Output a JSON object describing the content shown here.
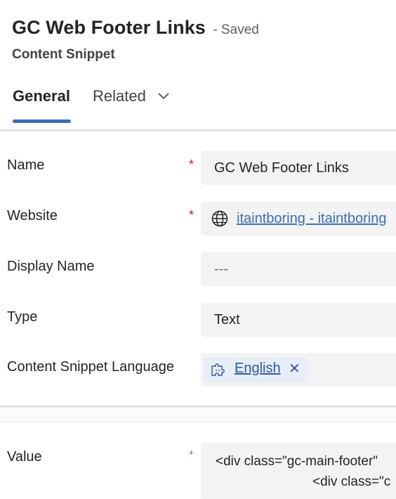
{
  "header": {
    "title": "GC Web Footer Links",
    "status": "- Saved",
    "entity_type": "Content Snippet"
  },
  "tabs": [
    {
      "label": "General",
      "active": true
    },
    {
      "label": "Related",
      "active": false
    }
  ],
  "form": {
    "name": {
      "label": "Name",
      "required": "*",
      "value": "GC Web Footer Links"
    },
    "website": {
      "label": "Website",
      "required": "*",
      "value": "itaintboring - itaintboring"
    },
    "display_name": {
      "label": "Display Name",
      "value": "---"
    },
    "type": {
      "label": "Type",
      "value": "Text"
    },
    "language": {
      "label": "Content Snippet Language",
      "value": "English",
      "remove": "✕"
    },
    "value": {
      "label": "Value",
      "recommended": "+",
      "line1": "<div class=\"gc-main-footer\"",
      "line2": "<div class=\"c"
    }
  },
  "icons": {
    "related_chevron": "chevron-down-icon",
    "website": "globe-icon",
    "language": "puzzle-icon",
    "remove": "close-icon"
  },
  "colors": {
    "accent": "#3a6fb6",
    "required": "#a4262c",
    "field_bg": "#f3f3f3"
  }
}
